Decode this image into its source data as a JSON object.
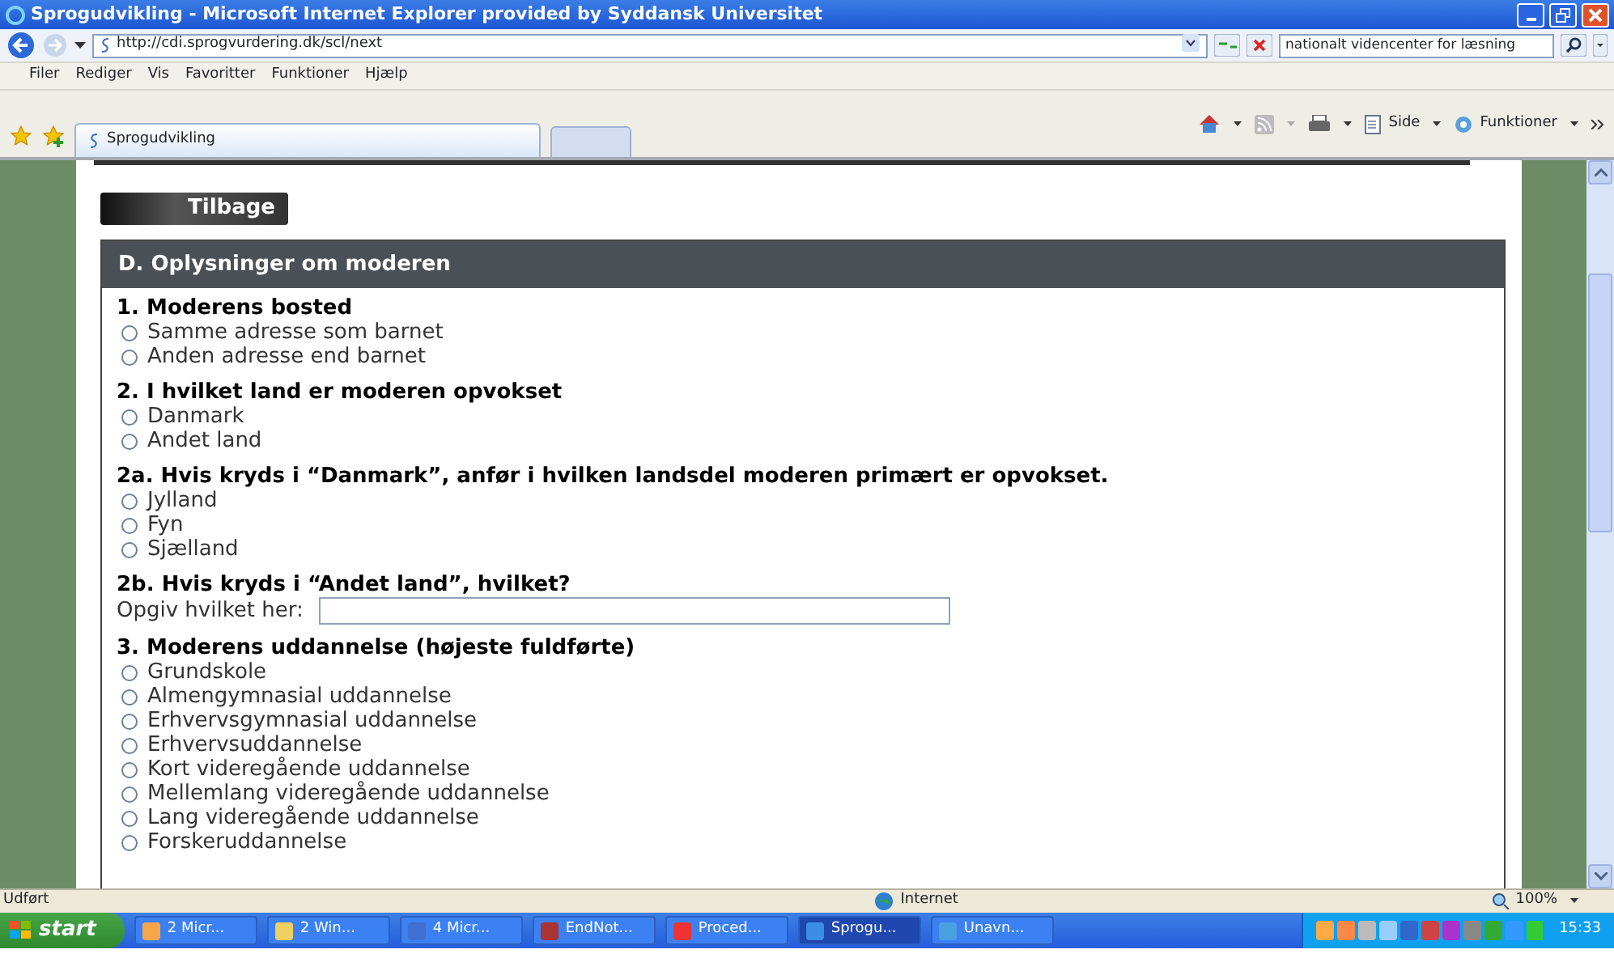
{
  "window": {
    "title": "Sprogudvikling - Microsoft Internet Explorer provided by Syddansk Universitet"
  },
  "address_bar": {
    "url": "http://cdi.sprogvurdering.dk/scl/next"
  },
  "search_field": {
    "value": "nationalt videncenter for læsning"
  },
  "menu": [
    "Filer",
    "Rediger",
    "Vis",
    "Favoritter",
    "Funktioner",
    "Hjælp"
  ],
  "tabs": [
    {
      "label": "Sprogudvikling",
      "selected": true
    }
  ],
  "command_bar": {
    "page": "Side",
    "tools": "Funktioner"
  },
  "page": {
    "back_button": "Tilbage",
    "section_title": "D. Oplysninger om moderen",
    "questions": [
      {
        "kind": "choice",
        "label": "1. Moderens bosted",
        "options": [
          {
            "label": "Samme adresse som barnet",
            "selected": false
          },
          {
            "label": "Anden adresse end barnet",
            "selected": false
          }
        ]
      },
      {
        "kind": "choice",
        "label": "2. I hvilket land er moderen opvokset",
        "options": [
          {
            "label": "Danmark",
            "selected": false
          },
          {
            "label": "Andet land",
            "selected": false
          }
        ]
      },
      {
        "kind": "choice",
        "label": "2a. Hvis kryds i “Danmark”, anfør i hvilken landsdel moderen primært er opvokset.",
        "options": [
          {
            "label": "Jylland",
            "selected": false
          },
          {
            "label": "Fyn",
            "selected": false
          },
          {
            "label": "Sjælland",
            "selected": false
          }
        ]
      },
      {
        "kind": "text",
        "label": "2b. Hvis kryds i “Andet land”, hvilket?",
        "field_label": "Opgiv hvilket her:"
      },
      {
        "kind": "choice",
        "label": "3. Moderens uddannelse (højeste fuldførte)",
        "options": [
          {
            "label": "Grundskole",
            "selected": false
          },
          {
            "label": "Almengymnasial uddannelse",
            "selected": false
          },
          {
            "label": "Erhvervsgymnasial uddannelse",
            "selected": false
          },
          {
            "label": "Erhvervsuddannelse",
            "selected": false
          },
          {
            "label": "Kort videregående uddannelse",
            "selected": false
          },
          {
            "label": "Mellemlang videregående uddannelse",
            "selected": false
          },
          {
            "label": "Lang videregående uddannelse",
            "selected": false
          },
          {
            "label": "Forskeruddannelse",
            "selected": false
          }
        ]
      }
    ]
  },
  "status_bar": {
    "text": "Udført",
    "zone": "Internet",
    "zoom": "100%"
  },
  "taskbar": {
    "start": "start",
    "tasks": [
      {
        "label": "2 Micr...",
        "selected": false
      },
      {
        "label": "2 Win...",
        "selected": false
      },
      {
        "label": "4 Micr...",
        "selected": false
      },
      {
        "label": "EndNot...",
        "selected": false
      },
      {
        "label": "Proced...",
        "selected": false
      },
      {
        "label": "Sprogu...",
        "selected": true
      },
      {
        "label": "Unavn...",
        "selected": false
      }
    ],
    "clock": "15:33"
  }
}
